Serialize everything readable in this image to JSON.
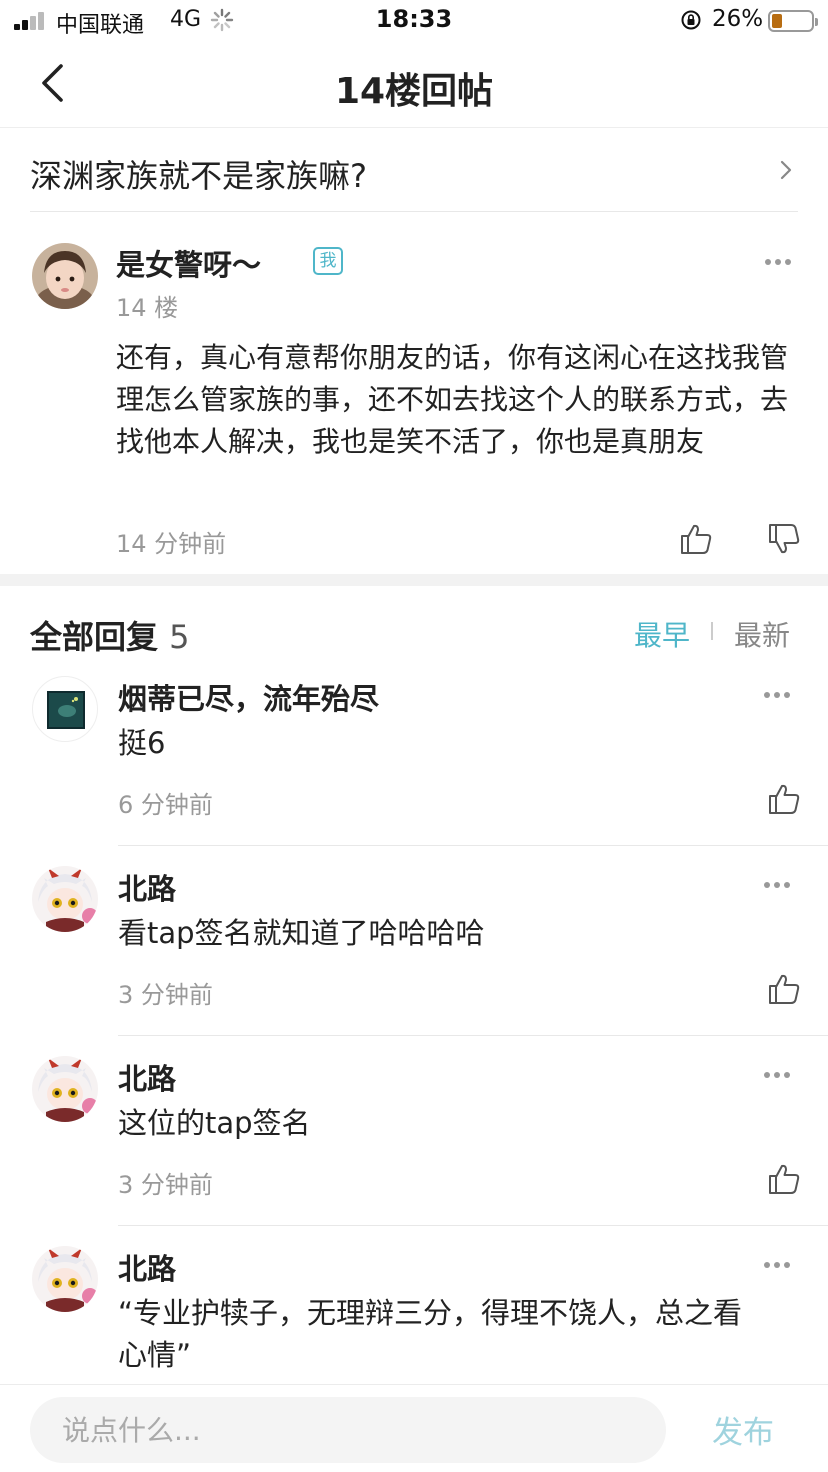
{
  "status_bar": {
    "carrier": "中国联通",
    "network": "4G",
    "time": "18:33",
    "battery": "26%",
    "battery_level": 0.26
  },
  "nav": {
    "title": "14楼回帖",
    "back_icon": "chevron-left-icon"
  },
  "thread": {
    "title": "深渊家族就不是家族嘛?"
  },
  "op_post": {
    "author": "是女警呀～",
    "badge": "我",
    "floor": "14 楼",
    "body": "还有，真心有意帮你朋友的话，你有这闲心在这找我管理怎么管家族的事，还不如去找这个人的联系方式，去找他本人解决，我也是笑不活了，你也是真朋友",
    "time": "14 分钟前"
  },
  "replies_header": {
    "title": "全部回复",
    "count": "5",
    "sort_earliest": "最早",
    "sort_latest": "最新",
    "active_color": "#4fb6c9"
  },
  "replies": [
    {
      "author": "烟蒂已尽，流年殆尽",
      "text": "挺6",
      "time": "6 分钟前"
    },
    {
      "author": "北路",
      "text": "看tap签名就知道了哈哈哈哈",
      "time": "3 分钟前"
    },
    {
      "author": "北路",
      "text": "这位的tap签名",
      "time": "3 分钟前"
    },
    {
      "author": "北路",
      "text": "“专业护犊子，无理辩三分，得理不饶人，总之看心情”"
    }
  ],
  "composer": {
    "placeholder": "说点什么...",
    "publish_label": "发布"
  }
}
